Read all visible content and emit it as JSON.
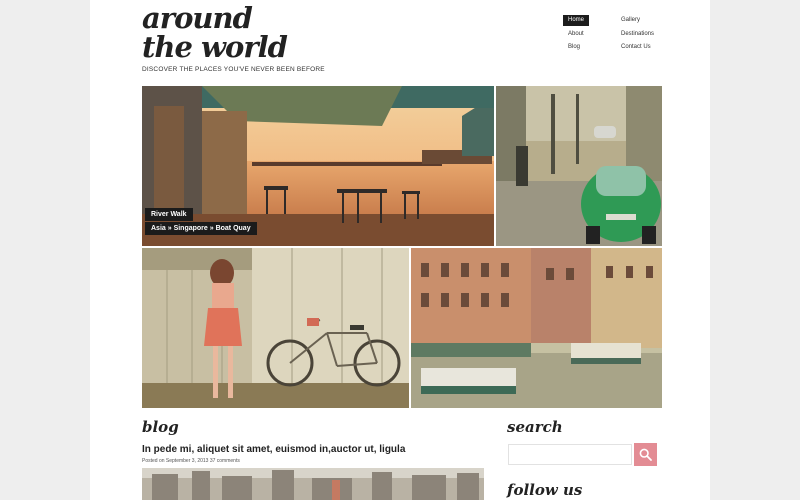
{
  "header": {
    "logo_line1": "around",
    "logo_line2": "the world",
    "tagline": "DISCOVER THE PLACES YOU'VE NEVER BEEN BEFORE"
  },
  "nav": {
    "items": [
      "Home",
      "About",
      "Blog",
      "Gallery",
      "Destinations",
      "Contact Us"
    ],
    "active": "Home"
  },
  "slider": {
    "caption_title": "River Walk",
    "caption_path": "Asia » Singapore » Boat Quay"
  },
  "blog": {
    "title": "blog",
    "post_title": "In pede mi, aliquet sit amet, euismod in,auctor ut, ligula",
    "post_meta": "Posted on September 3, 2013  37 comments"
  },
  "sidebar": {
    "search_title": "search",
    "search_placeholder": "",
    "follow_title": "follow us"
  },
  "colors": {
    "accent": "#e38c94",
    "dark": "#1b1b1b"
  }
}
